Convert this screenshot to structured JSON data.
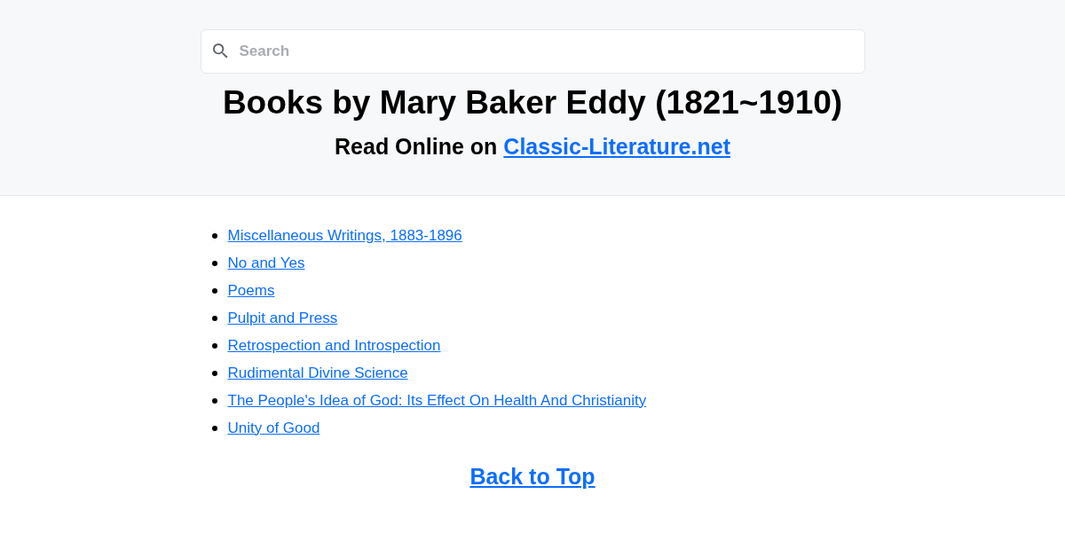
{
  "search": {
    "placeholder": "Search"
  },
  "title": "Books by Mary Baker Eddy (1821~1910)",
  "subtitle": {
    "text": "Read Online on",
    "link": "Classic-Literature.net"
  },
  "books": [
    "Miscellaneous Writings, 1883-1896",
    "No and Yes",
    "Poems",
    "Pulpit and Press",
    "Retrospection and Introspection",
    "Rudimental Divine Science",
    "The People's Idea of God: Its Effect On Health And Christianity",
    "Unity of Good"
  ],
  "back_to_top": "Back to Top"
}
